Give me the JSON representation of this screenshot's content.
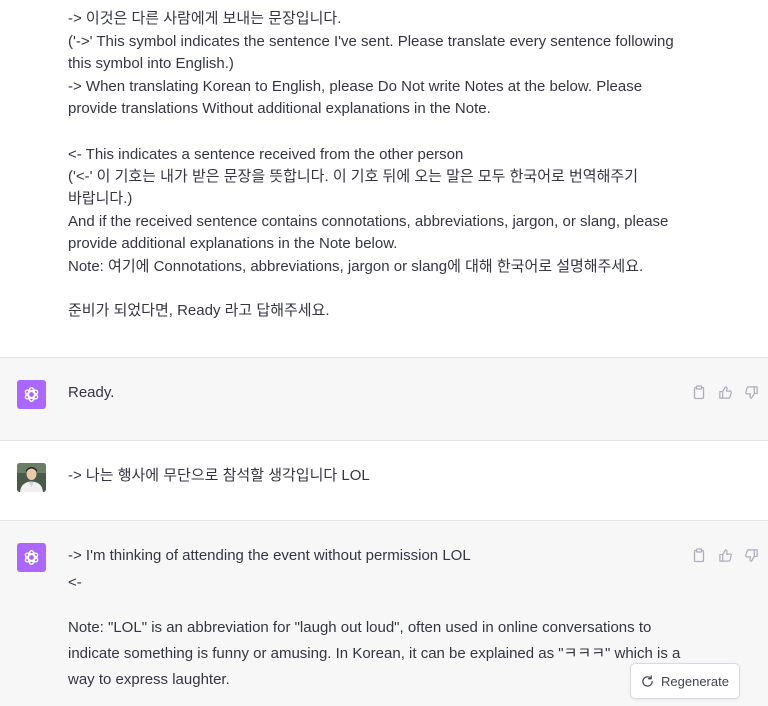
{
  "user_prompt": {
    "lines": [
      "-> 이것은 다른 사람에게 보내는 문장입니다.",
      "('->'  This symbol indicates the sentence I've sent. Please translate every sentence following",
      "this symbol into English.)",
      "-> When translating Korean to English, please Do Not write Notes at the below. Please",
      "provide translations Without additional explanations in the Note.",
      "",
      "<- This indicates a sentence received from the other person",
      "('<-' 이 기호는 내가 받은 문장을 뜻합니다. 이 기호 뒤에 오는 말은 모두 한국어로 번역해주기",
      "바랍니다.)",
      "And if the received sentence contains connotations, abbreviations, jargon, or slang, please",
      "provide additional explanations in the Note below.",
      "Note: 여기에 Connotations, abbreviations, jargon or slang에 대해 한국어로 설명해주세요.",
      "",
      "준비가 되었다면, Ready 라고 답해주세요."
    ]
  },
  "assistant_reply_1": {
    "text": "Ready."
  },
  "user_message_2": {
    "text": "-> 나는 행사에 무단으로 참석할 생각입니다 LOL"
  },
  "assistant_reply_2": {
    "lines": [
      "-> I'm thinking of attending the event without permission LOL",
      "<-",
      "",
      "Note: \"LOL\" is an abbreviation for \"laugh out loud\", often used in online conversations to",
      "indicate something is funny or amusing. In Korean, it can be explained as \"ㅋㅋㅋ\" which is a",
      "way to express laughter."
    ]
  },
  "regenerate_button": {
    "label": "Regenerate"
  },
  "icons": {
    "assistant_avatar": "openai-logo-icon",
    "copy": "clipboard-icon",
    "like": "thumbs-up-icon",
    "dislike": "thumbs-down-icon",
    "regenerate": "refresh-icon"
  },
  "colors": {
    "assistant_bg": "#f7f7f8",
    "avatar_bg": "#ab68ff",
    "text": "#343541",
    "icon": "#acacbe"
  }
}
